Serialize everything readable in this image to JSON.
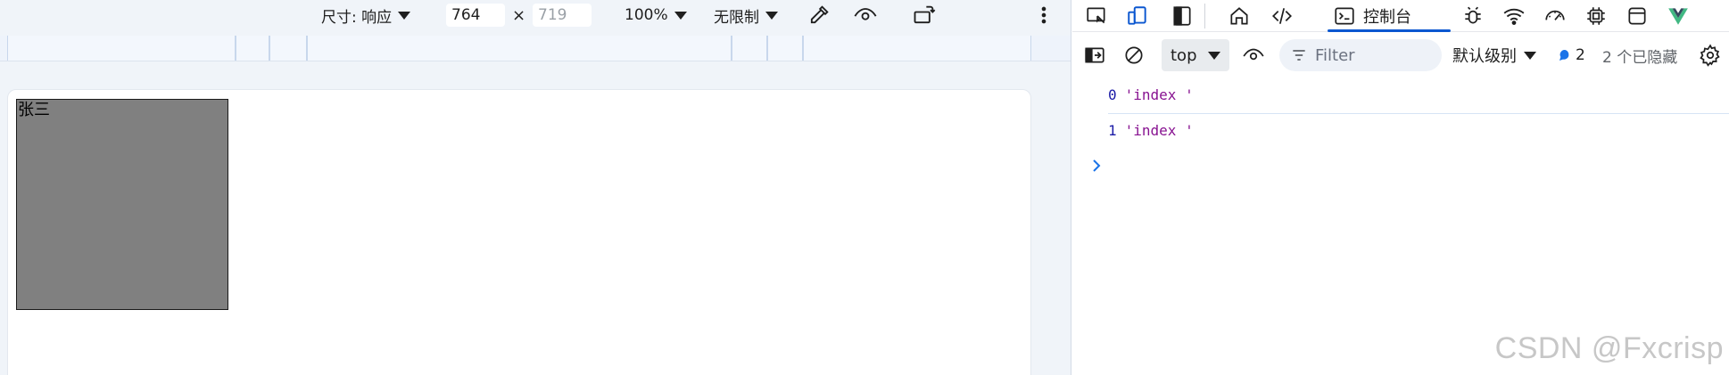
{
  "device_toolbar": {
    "dimensions_label": "尺寸: 响应",
    "width_value": "764",
    "times_symbol": "×",
    "height_placeholder": "719",
    "zoom": "100%",
    "throttle": "无限制"
  },
  "page": {
    "box_text": "张三"
  },
  "devtools": {
    "console_tab_label": "控制台",
    "context_select": "top",
    "filter_placeholder": "Filter",
    "level_select": "默认级别",
    "message_count": "2",
    "hidden_count": "2 个已隐藏",
    "logs": [
      {
        "index": "0",
        "value": "'index '"
      },
      {
        "index": "1",
        "value": "'index '"
      }
    ],
    "icons": [
      "inspect-icon",
      "device-toggle-icon",
      "dock-side-icon",
      "home-icon",
      "elements-icon",
      "console-icon",
      "bug-icon",
      "wifi-icon",
      "performance-icon",
      "memory-chip-icon",
      "application-icon",
      "vue-logo-icon"
    ]
  },
  "watermark": "CSDN @Fxcrisp",
  "colors": {
    "accent": "#0b57d0",
    "log_index": "#1a1aa6",
    "log_string": "#881391",
    "box_fill": "#808080"
  }
}
